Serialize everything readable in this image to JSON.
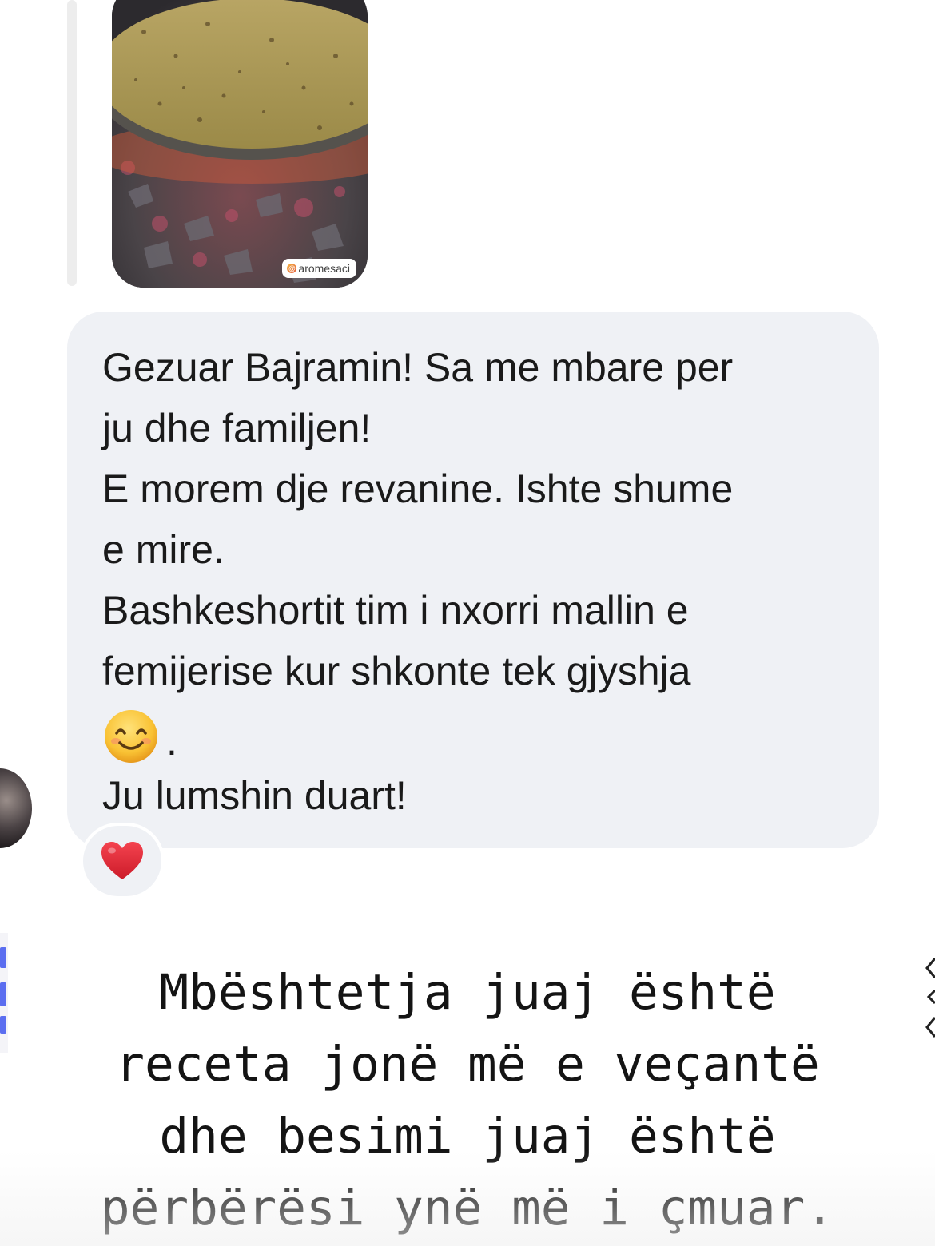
{
  "story_reply": {
    "image_tag": "aromesaci",
    "image_icon": "at-icon"
  },
  "message": {
    "paragraphs": [
      [
        "Gezuar Bajramin! Sa me mbare per",
        "ju dhe familjen!"
      ],
      [
        "E morem dje revanine. Ishte shume",
        "e mire."
      ],
      [
        "Bashkeshortit tim i nxorri mallin e",
        "femijerise kur shkonte tek gjyshja"
      ]
    ],
    "emoji": "smiling-face-icon",
    "emoji_suffix": ".",
    "closing": "Ju lumshin duart!"
  },
  "reaction": {
    "emoji": "red-heart-icon"
  },
  "caption": {
    "lines": [
      "Mbështetja juaj është",
      "receta jonë më e veçantë",
      "dhe besimi juaj është",
      "përbërësi ynë më i çmuar."
    ]
  },
  "colors": {
    "bubble": "#eff1f5",
    "text": "#1a1a1a",
    "heart": "#e0212f",
    "accent_edge": "#5b6ef0"
  }
}
